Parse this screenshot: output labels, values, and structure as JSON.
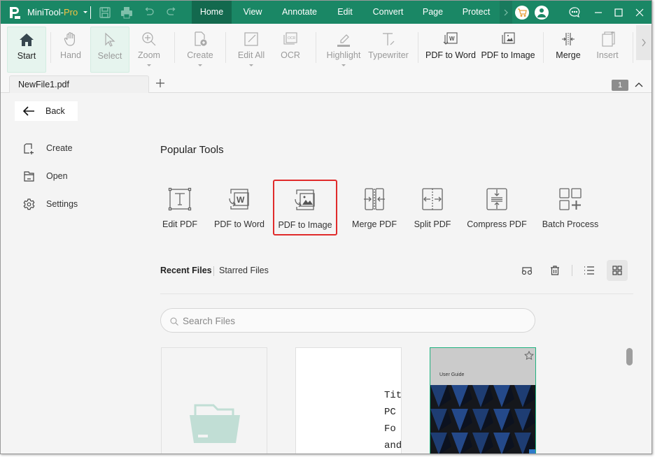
{
  "titlebar": {
    "app_name": "MiniTool-",
    "app_edition": "Pro",
    "colors": {
      "bar": "#1a8765",
      "active_tab": "#13694e",
      "pro_text": "#f5c342"
    },
    "quick_access": [
      "save-icon",
      "print-icon",
      "undo-icon",
      "redo-icon"
    ],
    "menu_tabs": [
      {
        "label": "Home",
        "active": true
      },
      {
        "label": "View",
        "active": false
      },
      {
        "label": "Annotate",
        "active": false
      },
      {
        "label": "Edit",
        "active": false
      },
      {
        "label": "Convert",
        "active": false
      },
      {
        "label": "Page",
        "active": false
      },
      {
        "label": "Protect",
        "active": false
      }
    ],
    "right_icons": [
      "cart-icon",
      "user-icon",
      "feedback-icon",
      "minimize-icon",
      "maximize-icon",
      "close-icon"
    ]
  },
  "ribbon": {
    "buttons": [
      {
        "label": "Start",
        "icon": "home-icon",
        "enabled": true,
        "selected": true,
        "dropdown": false
      },
      {
        "label": "Hand",
        "icon": "hand-icon",
        "enabled": false,
        "selected": false,
        "dropdown": false
      },
      {
        "label": "Select",
        "icon": "cursor-icon",
        "enabled": false,
        "selected": true,
        "dropdown": false
      },
      {
        "label": "Zoom",
        "icon": "zoom-in-icon",
        "enabled": false,
        "selected": false,
        "dropdown": true
      },
      {
        "label": "Create",
        "icon": "create-file-icon",
        "enabled": false,
        "selected": false,
        "dropdown": true
      },
      {
        "label": "Edit All",
        "icon": "edit-all-icon",
        "enabled": false,
        "selected": false,
        "dropdown": true
      },
      {
        "label": "OCR",
        "icon": "ocr-icon",
        "enabled": false,
        "selected": false,
        "dropdown": false
      },
      {
        "label": "Highlight",
        "icon": "highlighter-icon",
        "enabled": false,
        "selected": false,
        "dropdown": true
      },
      {
        "label": "Typewriter",
        "icon": "typewriter-icon",
        "enabled": false,
        "selected": false,
        "dropdown": false
      },
      {
        "label": "PDF to Word",
        "icon": "pdf-to-word-icon",
        "enabled": true,
        "selected": false,
        "dropdown": false
      },
      {
        "label": "PDF to Image",
        "icon": "pdf-to-image-icon",
        "enabled": true,
        "selected": false,
        "dropdown": false
      },
      {
        "label": "Merge",
        "icon": "merge-icon",
        "enabled": true,
        "selected": false,
        "dropdown": false
      },
      {
        "label": "Insert",
        "icon": "insert-page-icon",
        "enabled": false,
        "selected": false,
        "dropdown": false
      }
    ]
  },
  "tabs": {
    "document": "NewFile1.pdf",
    "page_count": "1"
  },
  "left_nav": {
    "back_label": "Back",
    "items": [
      {
        "label": "Create",
        "icon": "new-file-icon"
      },
      {
        "label": "Open",
        "icon": "folder-icon"
      },
      {
        "label": "Settings",
        "icon": "gear-icon"
      }
    ]
  },
  "main": {
    "section_title": "Popular Tools",
    "tools": [
      {
        "label": "Edit PDF",
        "icon": "edit-text-icon",
        "highlighted": false
      },
      {
        "label": "PDF to Word",
        "icon": "pdf-to-word-icon",
        "highlighted": false
      },
      {
        "label": "PDF to Image",
        "icon": "pdf-to-image-icon",
        "highlighted": true
      },
      {
        "label": "Merge PDF",
        "icon": "merge-icon",
        "highlighted": false
      },
      {
        "label": "Split PDF",
        "icon": "split-icon",
        "highlighted": false
      },
      {
        "label": "Compress PDF",
        "icon": "compress-icon",
        "highlighted": false
      },
      {
        "label": "Batch Process",
        "icon": "batch-icon",
        "highlighted": false
      }
    ],
    "highlight_color": "#e02b2b",
    "file_tabs": {
      "recent": "Recent Files",
      "starred": "Starred Files"
    },
    "file_actions": [
      "glasses-icon",
      "trash-icon",
      "list-view-icon",
      "grid-view-icon"
    ],
    "search_placeholder": "Search Files",
    "recent_cards": [
      {
        "type": "open-folder",
        "icon": "open-folder-icon"
      },
      {
        "type": "document",
        "lines": [
          "Tit",
          "PC",
          "Fo",
          "and"
        ]
      },
      {
        "type": "cover",
        "title": "User Guide",
        "starred": false
      }
    ]
  }
}
